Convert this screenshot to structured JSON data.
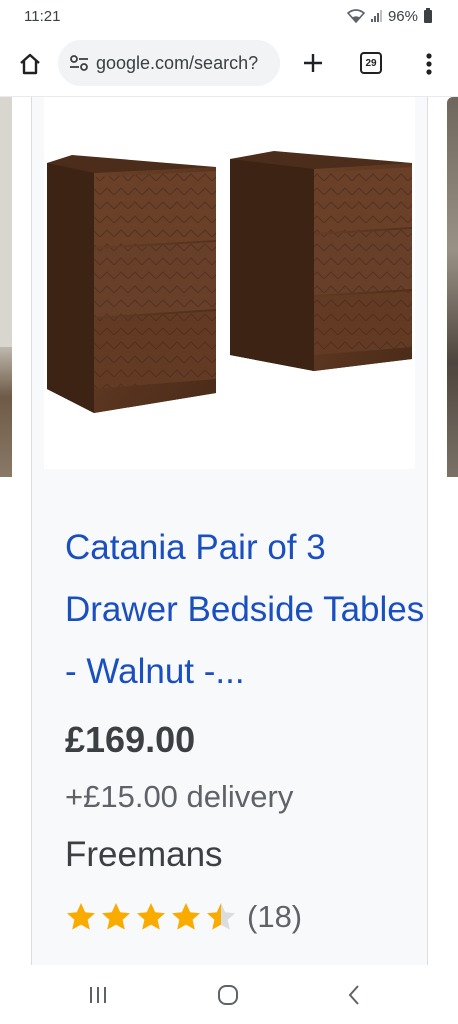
{
  "status_bar": {
    "time": "11:21",
    "battery": "96%",
    "icons": [
      "wifi-icon",
      "signal-icon",
      "battery-icon"
    ]
  },
  "browser": {
    "url": "google.com/search?",
    "tab_count": "29",
    "icons": [
      "home-icon",
      "tune-icon",
      "plus-icon",
      "tabs-icon",
      "more-vert-icon"
    ]
  },
  "product": {
    "title": "Catania Pair of 3 Drawer Bedside Tables - Walnut -...",
    "price": "£169.00",
    "delivery": "+£15.00 delivery",
    "merchant": "Freemans",
    "rating": 4.5,
    "rating_max": 5,
    "review_count": "(18)",
    "colors": {
      "title": "#1a4fbf",
      "star": "#f9ab00",
      "star_empty": "#dadce0"
    }
  },
  "nav_bar": {
    "icons": [
      "recents-icon",
      "home-circle-icon",
      "back-icon"
    ]
  }
}
